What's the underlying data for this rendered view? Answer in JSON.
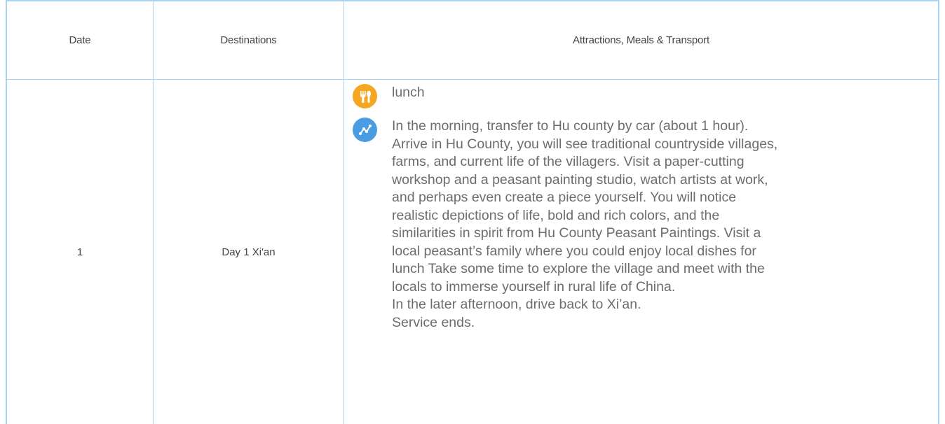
{
  "table": {
    "headers": {
      "date": "Date",
      "destinations": "Destinations",
      "details": "Attractions, Meals & Transport"
    },
    "rows": [
      {
        "date": "1",
        "destination": "Day 1 Xi'an",
        "activities": [
          {
            "icon": "meal-icon",
            "text": "lunch"
          },
          {
            "icon": "route-icon",
            "text": "In the morning, transfer to Hu county by car (about 1 hour).\nArrive in Hu County, you will see traditional countryside villages,\nfarms, and current life of the villagers. Visit a paper-cutting\nworkshop and a peasant painting studio, watch artists at work,\nand perhaps even create a piece yourself. You will notice\nrealistic depictions of life, bold and rich colors, and the\nsimilarities in spirit from Hu County Peasant Paintings. Visit a\nlocal peasant’s family where you could enjoy local dishes for\nlunch Take some time to explore the village and meet with the\nlocals to immerse yourself in rural life of China.\nIn the later afternoon, drive back to Xi’an.\nService ends."
          }
        ]
      }
    ]
  },
  "colors": {
    "border": "#a9d4f2",
    "meal_icon": "#f5a623",
    "route_icon": "#4a9de2",
    "text": "#6d6d6d"
  }
}
